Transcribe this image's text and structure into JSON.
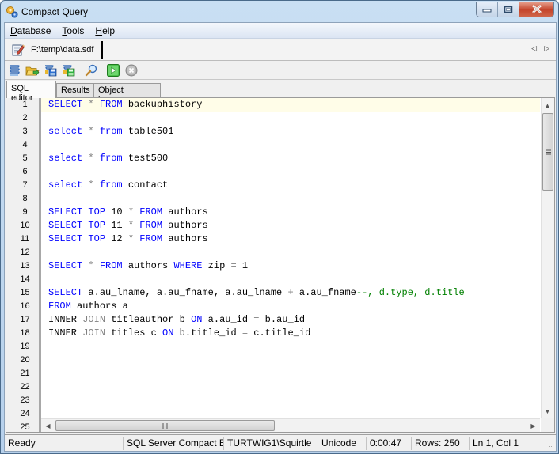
{
  "window": {
    "title": "Compact Query",
    "icon": "gears-icon",
    "controls": {
      "minimize": "minimize-icon",
      "maximize": "maximize-icon",
      "close": "close-icon"
    }
  },
  "menu": {
    "items": [
      {
        "label": "Database",
        "accel": "D",
        "rest": "atabase"
      },
      {
        "label": "Tools",
        "accel": "T",
        "rest": "ools"
      },
      {
        "label": "Help",
        "accel": "H",
        "rest": "elp"
      }
    ]
  },
  "file_tabs": {
    "items": [
      {
        "label": "F:\\temp\\data.sdf",
        "icon": "edit-document-icon"
      }
    ],
    "nav_prev": "◁",
    "nav_next": "▷"
  },
  "toolbar": {
    "buttons": [
      {
        "name": "new-query",
        "icon": "new-script-icon"
      },
      {
        "name": "open",
        "icon": "open-folder-icon"
      },
      {
        "name": "save",
        "icon": "save-icon"
      },
      {
        "name": "save-as",
        "icon": "save-as-icon"
      },
      {
        "name": "find",
        "icon": "search-icon"
      },
      {
        "name": "execute",
        "icon": "play-icon"
      },
      {
        "name": "stop",
        "icon": "stop-icon"
      }
    ]
  },
  "tabs": [
    {
      "label": "SQL editor",
      "active": true
    },
    {
      "label": "Results",
      "active": false
    },
    {
      "label": "Object browser",
      "active": false
    }
  ],
  "editor": {
    "current_line": 1,
    "line_numbers": [
      "1",
      "2",
      "3",
      "4",
      "5",
      "6",
      "7",
      "8",
      "9",
      "10",
      "11",
      "12",
      "13",
      "14",
      "15",
      "16",
      "17",
      "18",
      "19",
      "20",
      "21",
      "22",
      "23",
      "24",
      "25"
    ],
    "lines": [
      [
        {
          "t": "SELECT",
          "c": "kw"
        },
        {
          "t": " "
        },
        {
          "t": "*",
          "c": "op"
        },
        {
          "t": " "
        },
        {
          "t": "FROM",
          "c": "kw"
        },
        {
          "t": " backuphistory"
        }
      ],
      [],
      [
        {
          "t": "select",
          "c": "kw"
        },
        {
          "t": " "
        },
        {
          "t": "*",
          "c": "op"
        },
        {
          "t": " "
        },
        {
          "t": "from",
          "c": "kw"
        },
        {
          "t": " table501"
        }
      ],
      [],
      [
        {
          "t": "select",
          "c": "kw"
        },
        {
          "t": " "
        },
        {
          "t": "*",
          "c": "op"
        },
        {
          "t": " "
        },
        {
          "t": "from",
          "c": "kw"
        },
        {
          "t": " test500"
        }
      ],
      [],
      [
        {
          "t": "select",
          "c": "kw"
        },
        {
          "t": " "
        },
        {
          "t": "*",
          "c": "op"
        },
        {
          "t": " "
        },
        {
          "t": "from",
          "c": "kw"
        },
        {
          "t": " contact"
        }
      ],
      [],
      [
        {
          "t": "SELECT",
          "c": "kw"
        },
        {
          "t": " "
        },
        {
          "t": "TOP",
          "c": "kw"
        },
        {
          "t": " 10 "
        },
        {
          "t": "*",
          "c": "op"
        },
        {
          "t": " "
        },
        {
          "t": "FROM",
          "c": "kw"
        },
        {
          "t": " authors"
        }
      ],
      [
        {
          "t": "SELECT",
          "c": "kw"
        },
        {
          "t": " "
        },
        {
          "t": "TOP",
          "c": "kw"
        },
        {
          "t": " 11 "
        },
        {
          "t": "*",
          "c": "op"
        },
        {
          "t": " "
        },
        {
          "t": "FROM",
          "c": "kw"
        },
        {
          "t": " authors"
        }
      ],
      [
        {
          "t": "SELECT",
          "c": "kw"
        },
        {
          "t": " "
        },
        {
          "t": "TOP",
          "c": "kw"
        },
        {
          "t": " 12 "
        },
        {
          "t": "*",
          "c": "op"
        },
        {
          "t": " "
        },
        {
          "t": "FROM",
          "c": "kw"
        },
        {
          "t": " authors"
        }
      ],
      [],
      [
        {
          "t": "SELECT",
          "c": "kw"
        },
        {
          "t": " "
        },
        {
          "t": "*",
          "c": "op"
        },
        {
          "t": " "
        },
        {
          "t": "FROM",
          "c": "kw"
        },
        {
          "t": " authors "
        },
        {
          "t": "WHERE",
          "c": "kw"
        },
        {
          "t": " zip "
        },
        {
          "t": "=",
          "c": "op"
        },
        {
          "t": " 1"
        }
      ],
      [],
      [
        {
          "t": "SELECT",
          "c": "kw"
        },
        {
          "t": " a.au_lname, a.au_fname, a.au_lname "
        },
        {
          "t": "+",
          "c": "op"
        },
        {
          "t": " a.au_fname"
        },
        {
          "t": "--, d.type, d.title",
          "c": "cm"
        }
      ],
      [
        {
          "t": "FROM",
          "c": "kw"
        },
        {
          "t": " authors a"
        }
      ],
      [
        {
          "t": "INNER "
        },
        {
          "t": "JOIN",
          "c": "op"
        },
        {
          "t": " titleauthor b "
        },
        {
          "t": "ON",
          "c": "kw"
        },
        {
          "t": " a.au_id "
        },
        {
          "t": "=",
          "c": "op"
        },
        {
          "t": " b.au_id"
        }
      ],
      [
        {
          "t": "INNER "
        },
        {
          "t": "JOIN",
          "c": "op"
        },
        {
          "t": " titles c "
        },
        {
          "t": "ON",
          "c": "kw"
        },
        {
          "t": " b.title_id "
        },
        {
          "t": "=",
          "c": "op"
        },
        {
          "t": " c.title_id"
        }
      ],
      [],
      [],
      [],
      [],
      [],
      [],
      []
    ],
    "colors": {
      "keyword": "#0000ff",
      "operator": "#808080",
      "comment": "#008000",
      "current_line_bg": "#fffde8"
    }
  },
  "statusbar": {
    "cells": [
      {
        "name": "status-text",
        "text": "Ready"
      },
      {
        "name": "server-type",
        "text": "SQL Server Compact Edition"
      },
      {
        "name": "user",
        "text": "TURTWIG1\\Squirtle"
      },
      {
        "name": "encoding",
        "text": "Unicode"
      },
      {
        "name": "elapsed-time",
        "text": "0:00:47"
      },
      {
        "name": "row-count",
        "text": "Rows: 250"
      },
      {
        "name": "cursor-position",
        "text": "Ln 1, Col 1"
      }
    ]
  }
}
